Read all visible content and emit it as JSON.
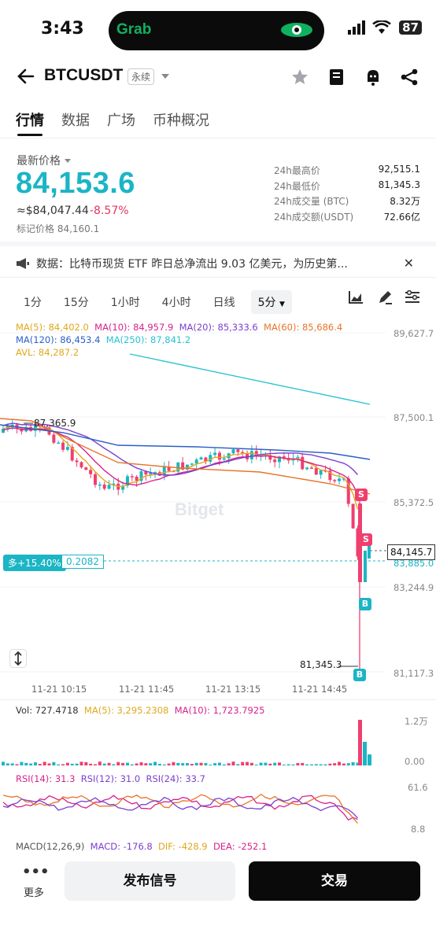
{
  "status_bar": {
    "time": "3:43",
    "island_app": "Grab",
    "battery": "87"
  },
  "header": {
    "symbol": "BTCUSDT",
    "contract_type": "永续"
  },
  "tabs": [
    {
      "label": "行情",
      "active": true
    },
    {
      "label": "数据",
      "active": false
    },
    {
      "label": "广场",
      "active": false
    },
    {
      "label": "币种概况",
      "active": false
    }
  ],
  "price": {
    "label": "最新价格",
    "last": "84,153.6",
    "usd": "≈$84,047.44",
    "change": "-8.57%",
    "mark": "标记价格 84,160.1"
  },
  "stats": [
    {
      "label": "24h最高价",
      "value": "92,515.1"
    },
    {
      "label": "24h最低价",
      "value": "81,345.3"
    },
    {
      "label": "24h成交量 (BTC)",
      "value": "8.32万"
    },
    {
      "label": "24h成交额(USDT)",
      "value": "72.66亿"
    }
  ],
  "news": {
    "text": "数据：比特币现货 ETF 昨日总净流出 9.03 亿美元，为历史第..."
  },
  "intervals": [
    "1分",
    "15分",
    "1小时",
    "4小时",
    "日线",
    "5分"
  ],
  "indicators": {
    "ma5": "MA(5): 84,402.0",
    "ma10": "MA(10): 84,957.9",
    "ma20": "MA(20): 85,333.6",
    "ma60": "MA(60): 85,686.4",
    "ma120": "MA(120): 86,453.4",
    "ma250": "MA(250): 87,841.2",
    "avl": "AVL: 84,287.2"
  },
  "price_axis": [
    "89,627.7",
    "87,500.1",
    "85,372.5",
    "83,885.0",
    "83,244.9",
    "81,117.3"
  ],
  "time_axis": [
    "11-21 10:15",
    "11-21 11:45",
    "11-21 13:15",
    "11-21 14:45"
  ],
  "chart_marks": {
    "high": "87,365.9",
    "low": "81,345.3",
    "current": "84,145.7",
    "position_tag": "多+15.40%",
    "position_value": "0.2082",
    "watermark": "Bitget",
    "sell_mark": "S",
    "buy_mark": "B"
  },
  "volume": {
    "vol": "Vol: 727.4718",
    "ma5": "MA(5): 3,295.2308",
    "ma10": "MA(10): 1,723.7925",
    "axis_top": "1.2万",
    "axis_bottom": "0.00"
  },
  "rsi": {
    "rsi14": "RSI(14): 31.3",
    "rsi12": "RSI(12): 31.0",
    "rsi24": "RSI(24): 33.7",
    "axis_top": "61.6",
    "axis_bottom": "8.8"
  },
  "macd": {
    "label": "MACD(12,26,9)",
    "macd": "MACD: -176.8",
    "dif": "DIF: -428.9",
    "dea": "DEA: -252.1"
  },
  "bottom_bar": {
    "more": "更多",
    "signal": "发布信号",
    "trade": "交易"
  },
  "colors": {
    "accent": "#1bb5c5",
    "down": "#ef3f6f",
    "ma5": "#e0a81b",
    "ma10": "#d8228c",
    "ma20": "#7b3fd0",
    "ma60": "#e7742a",
    "ma120": "#2b5fc8",
    "ma250": "#27c3d2"
  }
}
